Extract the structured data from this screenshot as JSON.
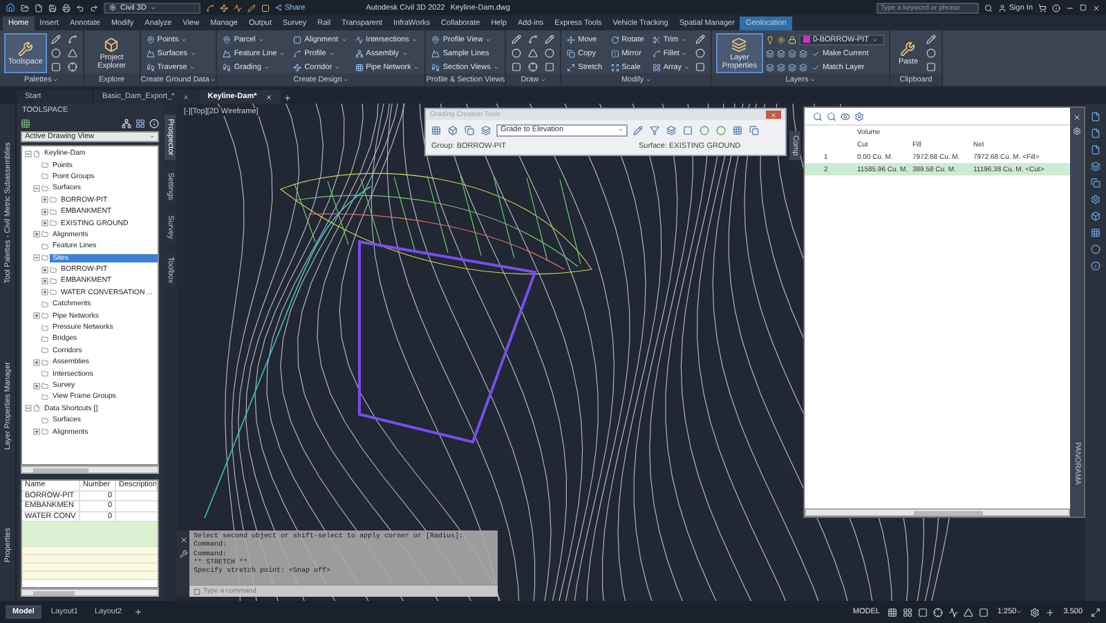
{
  "title_bar": {
    "workspace": "Civil 3D",
    "app_title": "Autodesk Civil 3D 2022",
    "file_name": "Keyline-Dam.dwg",
    "search": {
      "placeholder": "Type a keyword or phrase"
    },
    "sign_in": "Sign In",
    "share": "Share"
  },
  "ribbon_tabs": [
    {
      "label": "Home",
      "selected": true,
      "contextual": false
    },
    {
      "label": "Insert",
      "selected": false,
      "contextual": false
    },
    {
      "label": "Annotate",
      "selected": false,
      "contextual": false
    },
    {
      "label": "Modify",
      "selected": false,
      "contextual": false
    },
    {
      "label": "Analyze",
      "selected": false,
      "contextual": false
    },
    {
      "label": "View",
      "selected": false,
      "contextual": false
    },
    {
      "label": "Manage",
      "selected": false,
      "contextual": false
    },
    {
      "label": "Output",
      "selected": false,
      "contextual": false
    },
    {
      "label": "Survey",
      "selected": false,
      "contextual": false
    },
    {
      "label": "Rail",
      "selected": false,
      "contextual": false
    },
    {
      "label": "Transparent",
      "selected": false,
      "contextual": false
    },
    {
      "label": "InfraWorks",
      "selected": false,
      "contextual": false
    },
    {
      "label": "Collaborate",
      "selected": false,
      "contextual": false
    },
    {
      "label": "Help",
      "selected": false,
      "contextual": false
    },
    {
      "label": "Add-ins",
      "selected": false,
      "contextual": false
    },
    {
      "label": "Express Tools",
      "selected": false,
      "contextual": false
    },
    {
      "label": "Vehicle Tracking",
      "selected": false,
      "contextual": false
    },
    {
      "label": "Spatial Manager",
      "selected": false,
      "contextual": false
    },
    {
      "label": "Geolocation",
      "selected": false,
      "contextual": true
    }
  ],
  "ribbon_panels": [
    {
      "title": "Palettes",
      "menu": true,
      "items": [
        {
          "kind": "large",
          "label": "Toolspace",
          "selected": true
        },
        {
          "kind": "iconset"
        }
      ]
    },
    {
      "title": "Explore",
      "menu": false,
      "items": [
        {
          "kind": "large",
          "label": "Project Explorer",
          "selected": false
        }
      ]
    },
    {
      "title": "Create Ground Data",
      "menu": true,
      "items": [
        {
          "kind": "small",
          "label": "Points",
          "menu": true
        },
        {
          "kind": "small",
          "label": "Surfaces",
          "menu": true
        },
        {
          "kind": "small",
          "label": "Traverse",
          "menu": true
        }
      ]
    },
    {
      "title": "Create Design",
      "menu": true,
      "items": [
        {
          "kind": "small",
          "label": "Parcel",
          "menu": true
        },
        {
          "kind": "small",
          "label": "Feature Line",
          "menu": true
        },
        {
          "kind": "small",
          "label": "Grading",
          "menu": true
        },
        {
          "kind": "small",
          "label": "Alignment",
          "menu": true
        },
        {
          "kind": "small",
          "label": "Profile",
          "menu": true
        },
        {
          "kind": "small",
          "label": "Corridor",
          "menu": true
        },
        {
          "kind": "small",
          "label": "Intersections",
          "menu": true
        },
        {
          "kind": "small",
          "label": "Assembly",
          "menu": true
        },
        {
          "kind": "small",
          "label": "Pipe Network",
          "menu": true
        }
      ]
    },
    {
      "title": "Profile & Section Views",
      "menu": false,
      "items": [
        {
          "kind": "small",
          "label": "Profile View",
          "menu": true
        },
        {
          "kind": "small",
          "label": "Sample Lines",
          "menu": false
        },
        {
          "kind": "small",
          "label": "Section Views",
          "menu": true
        }
      ]
    },
    {
      "title": "Draw",
      "menu": true,
      "items": [
        {
          "kind": "iconset"
        }
      ]
    },
    {
      "title": "Modify",
      "menu": true,
      "items": [
        {
          "kind": "small",
          "label": "Move",
          "menu": false
        },
        {
          "kind": "small",
          "label": "Copy",
          "menu": false
        },
        {
          "kind": "small",
          "label": "Stretch",
          "menu": false
        },
        {
          "kind": "small",
          "label": "Rotate",
          "menu": false
        },
        {
          "kind": "small",
          "label": "Mirror",
          "menu": false
        },
        {
          "kind": "small",
          "label": "Scale",
          "menu": false
        },
        {
          "kind": "small",
          "label": "Trim",
          "menu": true
        },
        {
          "kind": "small",
          "label": "Fillet",
          "menu": true
        },
        {
          "kind": "small",
          "label": "Array",
          "menu": true
        },
        {
          "kind": "iconset"
        }
      ]
    },
    {
      "title": "Layers",
      "menu": true,
      "items": [
        {
          "kind": "large",
          "label": "Layer Properties",
          "selected": true
        },
        {
          "kind": "layer",
          "label": "0-BORROW-PIT",
          "color": "#cc33cc",
          "actions": [
            "Make Current",
            "Match Layer"
          ]
        }
      ]
    },
    {
      "title": "Clipboard",
      "menu": false,
      "items": [
        {
          "kind": "large",
          "label": "Paste",
          "selected": false
        },
        {
          "kind": "iconset"
        }
      ]
    }
  ],
  "document_tabs": [
    {
      "label": "Start",
      "selected": false,
      "closable": false
    },
    {
      "label": "Basic_Dam_Export_*",
      "selected": false,
      "closable": true
    },
    {
      "label": "Keyline-Dam*",
      "selected": true,
      "closable": true
    }
  ],
  "side_palettes": [
    "Tool Palettes - Civil Metric Subassemblies",
    "Layer Properties Manager",
    "Properties"
  ],
  "toolspace": {
    "title": "TOOLSPACE",
    "view": "Active Drawing View",
    "vertical_tabs": [
      {
        "label": "Prospector",
        "selected": true
      },
      {
        "label": "Settings",
        "selected": false
      },
      {
        "label": "Survey",
        "selected": false
      },
      {
        "label": "Toolbox",
        "selected": false
      }
    ],
    "tree": [
      {
        "label": "Keyline-Dam",
        "expanded": true,
        "selected": false,
        "children": [
          {
            "label": "Points",
            "selected": false
          },
          {
            "label": "Point Groups",
            "selected": false
          },
          {
            "label": "Surfaces",
            "expanded": true,
            "selected": false,
            "children": [
              {
                "label": "BORROW-PIT",
                "expanded": false,
                "selected": false
              },
              {
                "label": "EMBANKMENT",
                "expanded": false,
                "selected": false
              },
              {
                "label": "EXISTING GROUND",
                "expanded": false,
                "selected": false
              }
            ]
          },
          {
            "label": "Alignments",
            "expanded": false,
            "selected": false
          },
          {
            "label": "Feature Lines",
            "selected": false
          },
          {
            "label": "Sites",
            "expanded": true,
            "selected": true,
            "children": [
              {
                "label": "BORROW-PIT",
                "expanded": false,
                "selected": false
              },
              {
                "label": "EMBANKMENT",
                "expanded": false,
                "selected": false
              },
              {
                "label": "WATER CONVERSATION ...",
                "expanded": false,
                "selected": false
              }
            ]
          },
          {
            "label": "Catchments",
            "selected": false
          },
          {
            "label": "Pipe Networks",
            "expanded": false,
            "selected": false
          },
          {
            "label": "Pressure Networks",
            "selected": false
          },
          {
            "label": "Bridges",
            "selected": false
          },
          {
            "label": "Corridors",
            "selected": false
          },
          {
            "label": "Assemblies",
            "expanded": false,
            "selected": false
          },
          {
            "label": "Intersections",
            "selected": false
          },
          {
            "label": "Survey",
            "expanded": false,
            "selected": false
          },
          {
            "label": "View Frame Groups",
            "selected": false
          }
        ]
      },
      {
        "label": "Data Shortcuts []",
        "expanded": true,
        "selected": false,
        "children": [
          {
            "label": "Surfaces",
            "selected": false
          },
          {
            "label": "Alignments",
            "expanded": false,
            "selected": false
          }
        ]
      }
    ]
  },
  "properties_grid": {
    "columns": [
      "Name",
      "Number",
      "Description"
    ],
    "rows": [
      [
        "BORROW-PIT",
        "0"
      ],
      [
        "EMBANKMEN",
        "0"
      ],
      [
        "WATER CONV",
        "0"
      ]
    ],
    "blank_rows": [
      {
        "color": "#d9f2cf"
      },
      {
        "color": "#d9f2cf"
      },
      {
        "color": "#d9f2cf"
      },
      {
        "color": "#fbf8dc"
      },
      {
        "color": "#fbf8dc"
      },
      {
        "color": "#fbf8dc"
      },
      {
        "color": "#fbf8dc"
      }
    ]
  },
  "viewport_label": "[-][Top][2D Wireframe]",
  "grading_toolbar": {
    "title": "Grading Creation Tools",
    "criteria": "Grade to Elevation",
    "group": "Group: BORROW-PIT",
    "surface": "Surface: EXISTING GROUND"
  },
  "side_tab": "Comp",
  "panorama": {
    "title": "PANORAMA",
    "group_header": "Volume",
    "columns": [
      "Cut",
      "Fill",
      "Net"
    ],
    "rows": [
      {
        "index": "1",
        "cells": [
          "0.00 Cu. M.",
          "7972.68 Cu. M.",
          "7972.68 Cu. M. <Fill>"
        ],
        "selected": false
      },
      {
        "index": "2",
        "cells": [
          "11585.96 Cu. M.",
          "389.58 Cu. M.",
          "11196.38 Cu. M. <Cut>"
        ],
        "selected": true
      }
    ]
  },
  "command_line": {
    "history": [
      "Select second object or shift-select to apply corner or [Radius]:",
      "Command:",
      "Command:",
      "** STRETCH **",
      "Specify stretch point: <Snap off>"
    ],
    "placeholder": "Type a command"
  },
  "layout_tabs": [
    {
      "label": "Model",
      "selected": true
    },
    {
      "label": "Layout1",
      "selected": false
    },
    {
      "label": "Layout2",
      "selected": false
    }
  ],
  "status_bar": {
    "space": "MODEL",
    "scale": "1:250",
    "value": "3.500"
  }
}
